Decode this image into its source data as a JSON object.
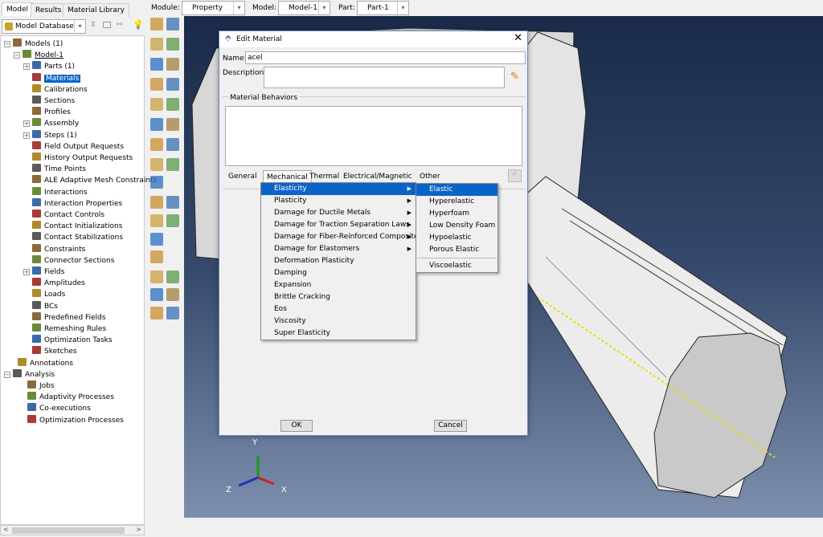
{
  "tabs": [
    "Model",
    "Results",
    "Material Library"
  ],
  "toolbar": {
    "module_label": "Module:",
    "module_value": "Property",
    "model_label": "Model:",
    "model_value": "Model-1",
    "part_label": "Part:",
    "part_value": "Part-1"
  },
  "tree_header": {
    "database": "Model Database"
  },
  "tree": [
    {
      "label": "Models (1)",
      "level": 0,
      "exp": "-"
    },
    {
      "label": "Model-1",
      "level": 1,
      "exp": "-"
    },
    {
      "label": "Parts (1)",
      "level": 2,
      "exp": "+"
    },
    {
      "label": "Materials",
      "level": 2,
      "selected": true
    },
    {
      "label": "Calibrations",
      "level": 2
    },
    {
      "label": "Sections",
      "level": 2
    },
    {
      "label": "Profiles",
      "level": 2
    },
    {
      "label": "Assembly",
      "level": 2,
      "exp": "+"
    },
    {
      "label": "Steps (1)",
      "level": 2,
      "exp": "+"
    },
    {
      "label": "Field Output Requests",
      "level": 2
    },
    {
      "label": "History Output Requests",
      "level": 2
    },
    {
      "label": "Time Points",
      "level": 2
    },
    {
      "label": "ALE Adaptive Mesh Constraints",
      "level": 2
    },
    {
      "label": "Interactions",
      "level": 2
    },
    {
      "label": "Interaction Properties",
      "level": 2
    },
    {
      "label": "Contact Controls",
      "level": 2
    },
    {
      "label": "Contact Initializations",
      "level": 2
    },
    {
      "label": "Contact Stabilizations",
      "level": 2
    },
    {
      "label": "Constraints",
      "level": 2
    },
    {
      "label": "Connector Sections",
      "level": 2
    },
    {
      "label": "Fields",
      "level": 2,
      "exp": "+"
    },
    {
      "label": "Amplitudes",
      "level": 2
    },
    {
      "label": "Loads",
      "level": 2
    },
    {
      "label": "BCs",
      "level": 2
    },
    {
      "label": "Predefined Fields",
      "level": 2
    },
    {
      "label": "Remeshing Rules",
      "level": 2
    },
    {
      "label": "Optimization Tasks",
      "level": 2
    },
    {
      "label": "Sketches",
      "level": 2
    },
    {
      "label": "Annotations",
      "level": 0.5
    },
    {
      "label": "Analysis",
      "level": 0,
      "exp": "-"
    },
    {
      "label": "Jobs",
      "level": 1.5
    },
    {
      "label": "Adaptivity Processes",
      "level": 1.5
    },
    {
      "label": "Co-executions",
      "level": 1.5
    },
    {
      "label": "Optimization Processes",
      "level": 1.5
    }
  ],
  "dialog": {
    "title": "Edit Material",
    "name_label": "Name:",
    "name_value": "acel",
    "description_label": "Description:",
    "behaviors_label": "Material Behaviors",
    "menubar": [
      "General",
      "Mechanical",
      "Thermal",
      "Electrical/Magnetic",
      "Other"
    ],
    "ok": "OK",
    "cancel": "Cancel"
  },
  "mechanical_menu": [
    {
      "label": "Elasticity",
      "sub": true,
      "highlighted": true
    },
    {
      "label": "Plasticity",
      "sub": true
    },
    {
      "label": "Damage for Ductile Metals",
      "sub": true
    },
    {
      "label": "Damage for Traction Separation Laws",
      "sub": true
    },
    {
      "label": "Damage for Fiber-Reinforced Composites",
      "sub": true
    },
    {
      "label": "Damage for Elastomers",
      "sub": true
    },
    {
      "label": "Deformation Plasticity"
    },
    {
      "label": "Damping"
    },
    {
      "label": "Expansion"
    },
    {
      "label": "Brittle Cracking"
    },
    {
      "label": "Eos"
    },
    {
      "label": "Viscosity"
    },
    {
      "label": "Super Elasticity"
    }
  ],
  "elasticity_menu": [
    {
      "label": "Elastic",
      "highlighted": true
    },
    {
      "label": "Hyperelastic"
    },
    {
      "label": "Hyperfoam"
    },
    {
      "label": "Low Density Foam"
    },
    {
      "label": "Hypoelastic"
    },
    {
      "label": "Porous Elastic"
    },
    {
      "label": "Viscoelastic",
      "separator_before": true
    }
  ],
  "triad": {
    "x": "X",
    "y": "Y",
    "z": "Z"
  },
  "colors": {
    "highlight": "#0a64c8",
    "viewport_top": "#1a2a48",
    "viewport_bottom": "#7e8fae"
  }
}
